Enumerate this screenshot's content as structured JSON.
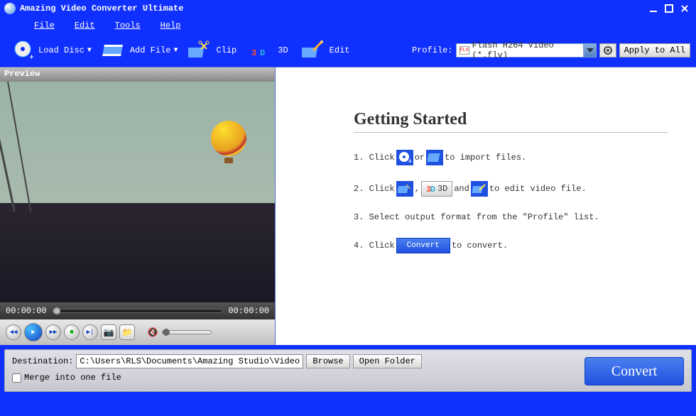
{
  "titlebar": {
    "title": "Amazing Video Converter Ultimate"
  },
  "menubar": {
    "items": [
      "File",
      "Edit",
      "Tools",
      "Help"
    ]
  },
  "toolbar": {
    "load_disc": "Load Disc",
    "add_file": "Add File",
    "clip": "Clip",
    "threeD": "3D",
    "edit": "Edit",
    "profile_label": "Profile:",
    "profile_value": "Flash H264 Video (*.flv)",
    "apply_all": "Apply to All"
  },
  "preview": {
    "label": "Preview",
    "time_start": "00:00:00",
    "time_end": "00:00:00"
  },
  "getting_started": {
    "title": "Getting Started",
    "step1_a": "1. Click ",
    "step1_or": " or ",
    "step1_b": " to import files.",
    "step2_a": "2. Click ",
    "step2_comma": ", ",
    "step2_3d": "3D",
    "step2_and": " and ",
    "step2_b": " to edit video file.",
    "step3": "3. Select output format from the \"Profile\" list.",
    "step4_a": "4. Click ",
    "step4_convert": "Convert",
    "step4_b": " to convert."
  },
  "bottom": {
    "destination_label": "Destination:",
    "destination_value": "C:\\Users\\RLS\\Documents\\Amazing Studio\\Video",
    "browse": "Browse",
    "open_folder": "Open Folder",
    "merge": "Merge into one file",
    "convert": "Convert"
  }
}
